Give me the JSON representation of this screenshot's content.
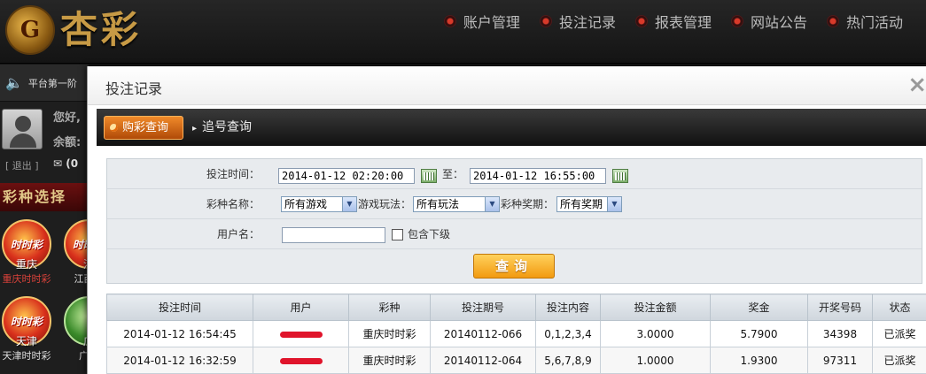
{
  "brand": {
    "logo_glyph": "G",
    "logo_text": "杏彩"
  },
  "topnav": [
    {
      "label": "账户管理"
    },
    {
      "label": "投注记录"
    },
    {
      "label": "报表管理"
    },
    {
      "label": "网站公告"
    },
    {
      "label": "热门活动"
    }
  ],
  "sidebar": {
    "notice": "平台第一阶",
    "greeting": "您好,",
    "balance_label": "余额:",
    "logout": "[ 退出 ]",
    "mail_count": "(0",
    "section_title": "彩种选择",
    "games": [
      {
        "icon_text": "时时彩",
        "label": "重庆",
        "sub": "重庆时时彩"
      },
      {
        "icon_text": "时时彩",
        "label": "江",
        "sub": "江西时"
      },
      {
        "icon_text": "时时彩",
        "label": "天津",
        "sub": "天津时时彩"
      },
      {
        "icon_text": "",
        "label": "广",
        "sub": "广东"
      }
    ]
  },
  "modal": {
    "title": "投注记录",
    "close": "×",
    "tabs": {
      "active": "购彩查询",
      "inactive": "追号查询"
    },
    "filter": {
      "time_label": "投注时间：",
      "time_from": "2014-01-12 02:20:00",
      "to_label": "至：",
      "time_to": "2014-01-12 16:55:00",
      "game_label": "彩种名称：",
      "game_value": "所有游戏",
      "play_label": "游戏玩法：",
      "play_value": "所有玩法",
      "period_label": "彩种奖期：",
      "period_value": "所有奖期",
      "user_label": "用户名：",
      "user_value": "",
      "include_sub_label": "包含下级",
      "query_button": "查询"
    },
    "table": {
      "headers": [
        "投注时间",
        "用户",
        "彩种",
        "投注期号",
        "投注内容",
        "投注金额",
        "奖金",
        "开奖号码",
        "状态"
      ],
      "rows": [
        {
          "time": "2014-01-12 16:54:45",
          "game": "重庆时时彩",
          "period": "20140112-066",
          "content": "0,1,2,3,4",
          "amount": "3.0000",
          "prize": "5.7900",
          "draw": "34398",
          "status": "已派奖"
        },
        {
          "time": "2014-01-12 16:32:59",
          "game": "重庆时时彩",
          "period": "20140112-064",
          "content": "5,6,7,8,9",
          "amount": "1.0000",
          "prize": "1.9300",
          "draw": "97311",
          "status": "已派奖"
        }
      ]
    }
  }
}
